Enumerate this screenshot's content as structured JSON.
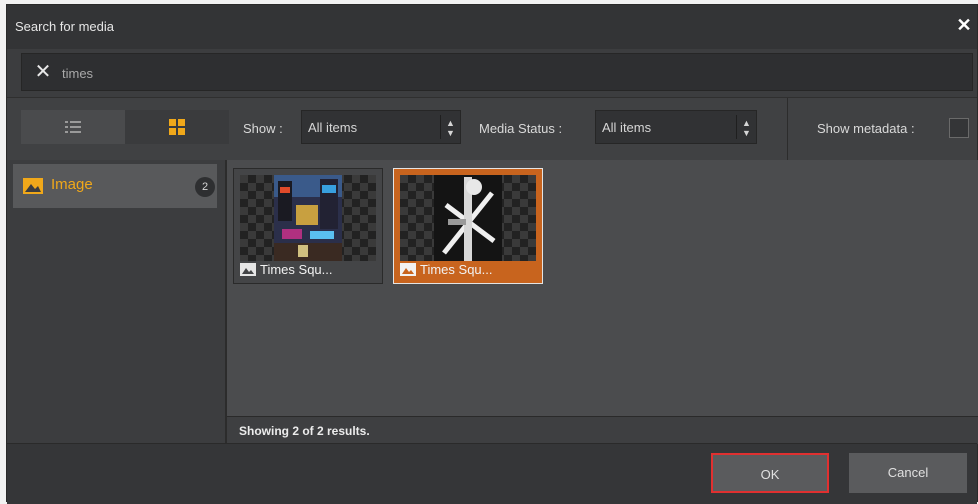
{
  "dialog": {
    "title": "Search for media"
  },
  "search": {
    "value": "times",
    "placeholder": ""
  },
  "toolbar": {
    "show_label": "Show :",
    "show_value": "All items",
    "status_label": "Media Status :",
    "status_value": "All items",
    "metadata_label": "Show metadata :",
    "metadata_checked": false
  },
  "sidebar": {
    "items": [
      {
        "label": "Image",
        "count": "2",
        "selected": true
      }
    ]
  },
  "results": {
    "items": [
      {
        "caption": "Times Squ...",
        "selected": false
      },
      {
        "caption": "Times Squ...",
        "selected": true
      }
    ],
    "status": "Showing 2 of 2 results."
  },
  "footer": {
    "ok_label": "OK",
    "cancel_label": "Cancel"
  },
  "colors": {
    "accent": "#f0a81a",
    "selection": "#c8641e",
    "highlight_border": "#e03030"
  }
}
